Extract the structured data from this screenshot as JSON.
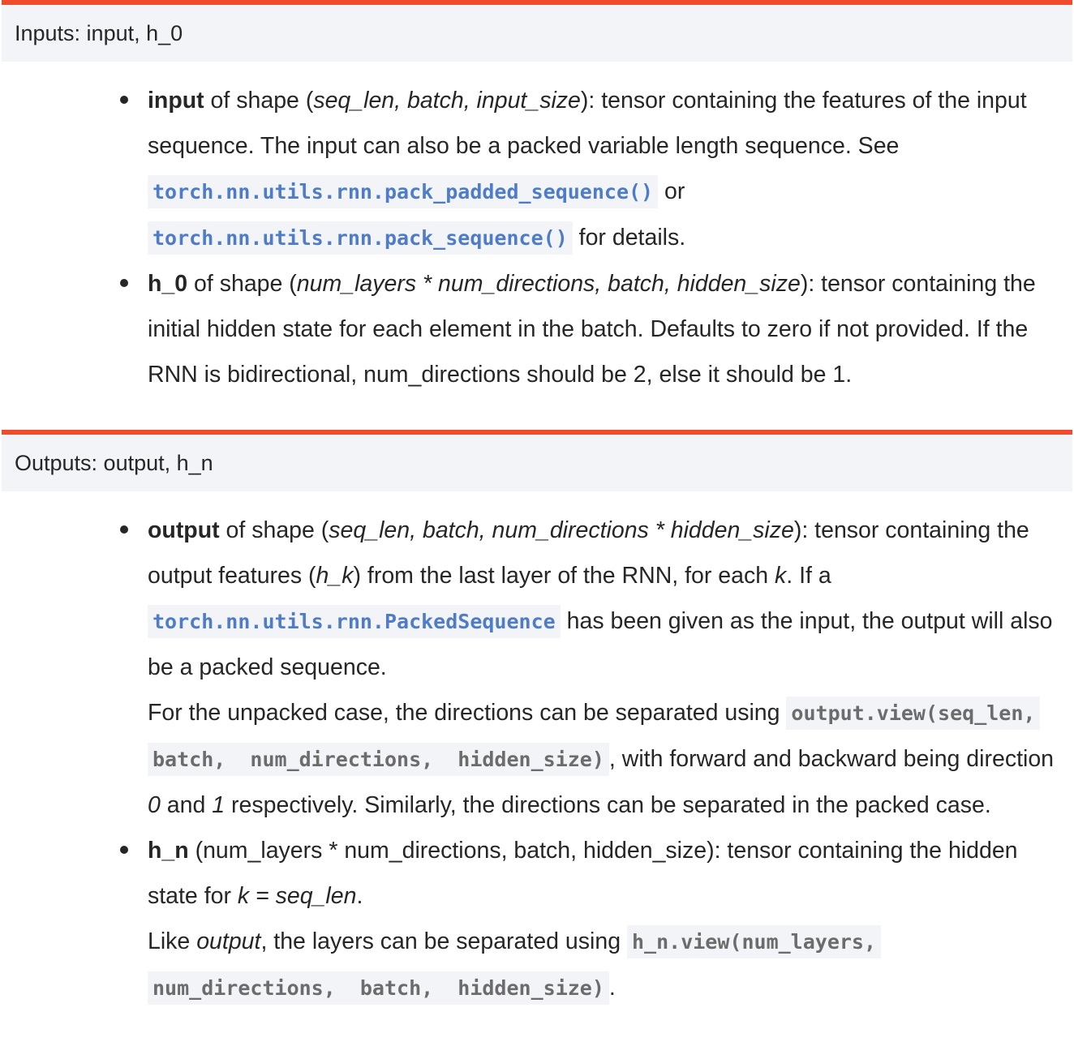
{
  "inputs": {
    "header": "Inputs: input, h_0",
    "input_param": {
      "name": "input",
      "t1": " of shape (",
      "shape": "seq_len, batch, input_size",
      "t2": "): tensor containing the features of the input",
      "t3": "sequence. The input can also be a packed variable length sequence. See",
      "ref1": "torch.nn.utils.rnn.pack_padded_sequence()",
      "t4": " or",
      "ref2": "torch.nn.utils.rnn.pack_sequence()",
      "t5": " for details."
    },
    "h0_param": {
      "name": "h_0",
      "t1": " of shape (",
      "shape": "num_layers * num_directions, batch, hidden_size",
      "t2": "): tensor containing the",
      "t3": "initial hidden state for each element in the batch. Defaults to zero if not provided. If the",
      "t4": "RNN is bidirectional, num_directions should be 2, else it should be 1."
    }
  },
  "outputs": {
    "header": "Outputs: output, h_n",
    "output_param": {
      "name": "output",
      "t1": " of shape (",
      "shape": "seq_len, batch, num_directions * hidden_size",
      "t2": "): tensor containing the",
      "t3a": "output features (",
      "hk": "h_k",
      "t3b": ") from the last layer of the RNN, for each ",
      "k": "k",
      "t3c": ". If a",
      "ref1": "torch.nn.utils.rnn.PackedSequence",
      "t4": " has been given as the input, the output will also",
      "t5": "be a packed sequence.",
      "t6": "For the unpacked case, the directions can be separated using ",
      "code1a": "output.view(seq_len,",
      "code1b": "batch,  num_directions,  hidden_size)",
      "t7": ", with forward and backward being direction",
      "zero": "0",
      "t8a": " and ",
      "one": "1",
      "t8b": " respectively. Similarly, the directions can be separated in the packed case."
    },
    "hn_param": {
      "name": "h_n",
      "t1": " (num_layers * num_directions, batch, hidden_size): tensor containing the hidden",
      "t2a": "state for ",
      "keq": "k = seq_len",
      "t2b": ".",
      "t3a": "Like ",
      "output_it": "output",
      "t3b": ", the layers can be separated using ",
      "code1a": "h_n.view(num_layers,",
      "code1b": "num_directions,  batch,  hidden_size)",
      "t4": "."
    }
  }
}
